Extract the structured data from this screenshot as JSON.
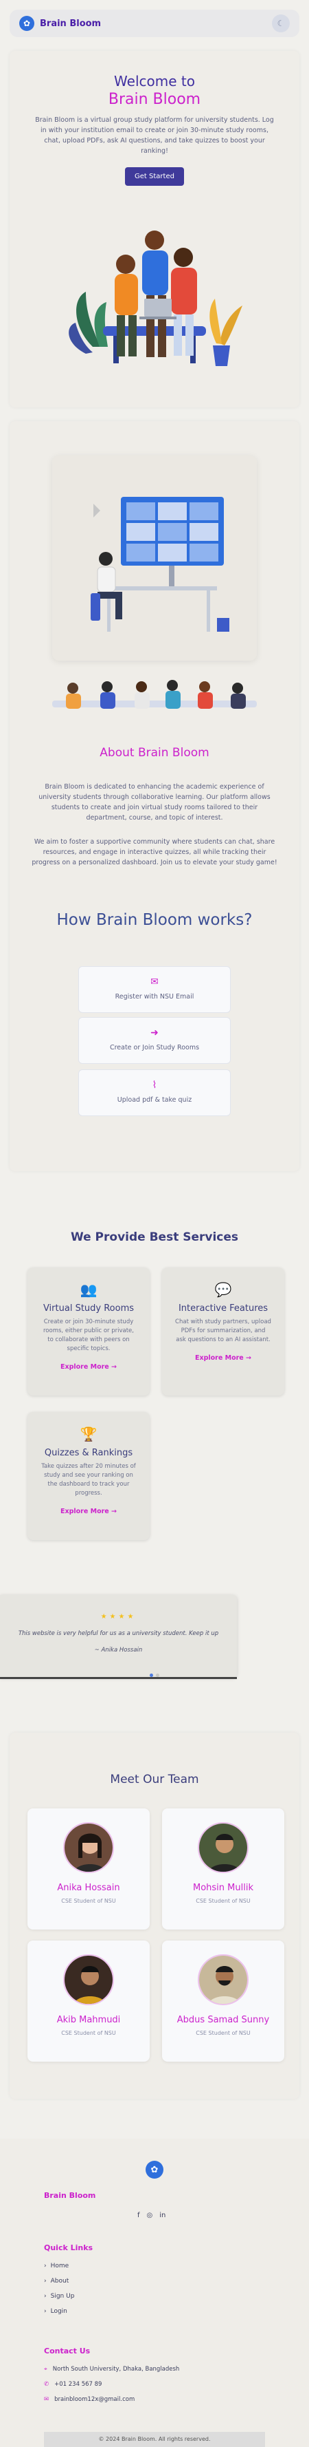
{
  "nav": {
    "brand": "Brain Bloom",
    "brand_icon": "brain-icon",
    "toggle_icon": "moon-icon"
  },
  "hero": {
    "title_line1": "Welcome to",
    "title_line2": "Brain Bloom",
    "description": "Brain Bloom is a virtual group study platform for university students. Log in with your institution email to create or join 30-minute study rooms, chat, upload PDFs, ask AI questions, and take quizzes to boost your ranking!",
    "cta": "Get Started"
  },
  "about": {
    "title": "About Brain Bloom",
    "para1": "Brain Bloom is dedicated to enhancing the academic experience of university students through collaborative learning. Our platform allows students to create and join virtual study rooms tailored to their department, course, and topic of interest.",
    "para2": "We aim to foster a supportive community where students can chat, share resources, and engage in interactive quizzes, all while tracking their progress on a personalized dashboard. Join us to elevate your study game!"
  },
  "how": {
    "title": "How Brain Bloom works?",
    "steps": [
      {
        "icon": "envelope-icon",
        "label": "Register with NSU Email"
      },
      {
        "icon": "sign-in-icon",
        "label": "Create or Join Study Rooms"
      },
      {
        "icon": "paperclip-icon",
        "label": "Upload pdf & take quiz"
      }
    ]
  },
  "services": {
    "title": "We Provide Best Services",
    "items": [
      {
        "icon": "users-icon",
        "title": "Virtual Study Rooms",
        "desc": "Create or join 30-minute study rooms, either public or private, to collaborate with peers on specific topics.",
        "link": "Explore More →"
      },
      {
        "icon": "chat-icon",
        "title": "Interactive Features",
        "desc": "Chat with study partners, upload PDFs for summarization, and ask questions to an AI assistant.",
        "link": "Explore More →"
      },
      {
        "icon": "trophy-icon",
        "title": "Quizzes & Rankings",
        "desc": "Take quizzes after 20 minutes of study and see your ranking on the dashboard to track your progress.",
        "link": "Explore More →"
      }
    ]
  },
  "testimonial": {
    "stars": "★★★★",
    "rating": 4,
    "quote": "This website is very helpful for us as a university student. Keep it up",
    "author": "~ Anika Hossain"
  },
  "team": {
    "title": "Meet Our Team",
    "members": [
      {
        "name": "Anika Hossain",
        "role": "CSE Student of NSU"
      },
      {
        "name": "Mohsin Mullik",
        "role": "CSE Student of NSU"
      },
      {
        "name": "Akib Mahmudi",
        "role": "CSE Student of NSU"
      },
      {
        "name": "Abdus Samad Sunny",
        "role": "CSE Student of NSU"
      }
    ]
  },
  "footer": {
    "brand": "Brain Bloom",
    "socials": [
      "f",
      "◎",
      "in"
    ],
    "quick_links_title": "Quick Links",
    "links": [
      "Home",
      "About",
      "Sign Up",
      "Login"
    ],
    "contact_title": "Contact Us",
    "address": "North South University, Dhaka, Bangladesh",
    "phone": "+01 234 567 89",
    "email": "brainbloom12x@gmail.com",
    "copyright": "© 2024 Brain Bloom. All rights reserved."
  }
}
